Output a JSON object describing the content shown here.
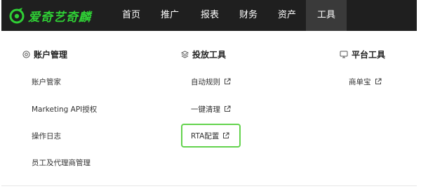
{
  "brand": {
    "logo_text": "爱奇艺奇麟",
    "accent": "#2fcf35"
  },
  "nav": {
    "items": [
      {
        "label": "首页"
      },
      {
        "label": "推广"
      },
      {
        "label": "报表"
      },
      {
        "label": "财务"
      },
      {
        "label": "资产"
      },
      {
        "label": "工具",
        "active": true
      }
    ]
  },
  "menu": {
    "columns": [
      {
        "title": "账户管理",
        "icon": "settings-circle-icon",
        "items": [
          "账户管家",
          "Marketing API授权",
          "操作日志",
          "员工及代理商管理"
        ]
      },
      {
        "title": "投放工具",
        "icon": "layers-icon",
        "items": [
          "自动规则",
          "一键清理",
          "RTA配置"
        ]
      },
      {
        "title": "平台工具",
        "icon": "monitor-icon",
        "items": [
          "商单宝"
        ]
      }
    ],
    "highlighted_item": "RTA配置",
    "highlight_color": "#63d34d"
  }
}
